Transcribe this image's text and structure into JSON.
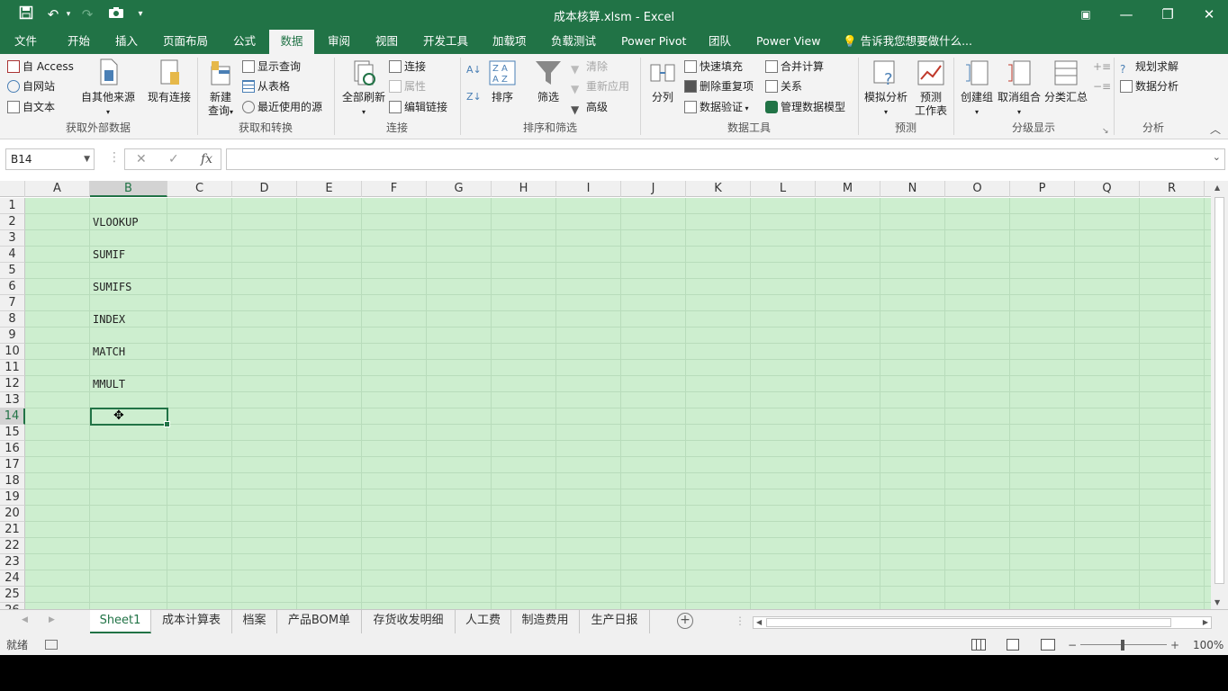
{
  "window": {
    "title": "成本核算.xlsm - Excel",
    "qat": [
      "save-icon",
      "undo-icon",
      "redo-icon",
      "camera-icon",
      "customize-icon"
    ],
    "controls": {
      "ribbon_options": "▣",
      "minimize": "—",
      "restore": "❐",
      "close": "✕"
    }
  },
  "tabs": [
    "文件",
    "开始",
    "插入",
    "页面布局",
    "公式",
    "数据",
    "审阅",
    "视图",
    "开发工具",
    "加载项",
    "负载测试",
    "Power Pivot",
    "团队",
    "Power View"
  ],
  "active_tab": "数据",
  "tell_me": "告诉我您想要做什么...",
  "ribbon": {
    "get_external": {
      "label": "获取外部数据",
      "access": "自 Access",
      "web": "自网站",
      "text": "自文本",
      "other": "自其他来源",
      "existing": "现有连接"
    },
    "get_transform": {
      "label": "获取和转换",
      "new_query_1": "新建",
      "new_query_2": "查询",
      "show_queries": "显示查询",
      "from_table": "从表格",
      "recent_sources": "最近使用的源"
    },
    "connections": {
      "label": "连接",
      "refresh_all": "全部刷新",
      "connections": "连接",
      "properties": "属性",
      "edit_links": "编辑链接"
    },
    "sort_filter": {
      "label": "排序和筛选",
      "sort": "排序",
      "filter": "筛选",
      "clear": "清除",
      "reapply": "重新应用",
      "advanced": "高级"
    },
    "data_tools": {
      "label": "数据工具",
      "text_to_columns": "分列",
      "flash_fill": "快速填充",
      "remove_dup": "删除重复项",
      "validation": "数据验证",
      "consolidate": "合并计算",
      "relationships": "关系",
      "manage_model": "管理数据模型"
    },
    "forecast": {
      "label": "预测",
      "what_if": "模拟分析",
      "sheet_1": "预测",
      "sheet_2": "工作表"
    },
    "outline": {
      "label": "分级显示",
      "group": "创建组",
      "ungroup": "取消组合",
      "subtotal": "分类汇总"
    },
    "analysis": {
      "label": "分析",
      "solver": "规划求解",
      "data_analysis": "数据分析"
    }
  },
  "formula_bar": {
    "name_box": "B14",
    "cancel": "✕",
    "enter": "✓",
    "fx": "fx",
    "value": ""
  },
  "grid": {
    "columns": [
      "A",
      "B",
      "C",
      "D",
      "E",
      "F",
      "G",
      "H",
      "I",
      "J",
      "K",
      "L",
      "M",
      "N",
      "O",
      "P",
      "Q",
      "R"
    ],
    "rows": [
      "1",
      "2",
      "3",
      "4",
      "5",
      "6",
      "7",
      "8",
      "9",
      "10",
      "11",
      "12",
      "13",
      "14",
      "15",
      "16",
      "17",
      "18",
      "19",
      "20",
      "21",
      "22",
      "23",
      "24",
      "25",
      "26"
    ],
    "cells": [
      {
        "ref": "B2",
        "text": "VLOOKUP"
      },
      {
        "ref": "B4",
        "text": "SUMIF"
      },
      {
        "ref": "B6",
        "text": "SUMIFS"
      },
      {
        "ref": "B8",
        "text": "INDEX"
      },
      {
        "ref": "B10",
        "text": "MATCH"
      },
      {
        "ref": "B12",
        "text": "MMULT"
      }
    ],
    "selected": "B14",
    "cell_color": "#cdeecf"
  },
  "sheets": [
    "Sheet1",
    "成本计算表",
    "档案",
    "产品BOM单",
    "存货收发明细",
    "人工费",
    "制造费用",
    "生产日报"
  ],
  "active_sheet": "Sheet1",
  "status": {
    "ready": "就绪",
    "zoom": "100%"
  },
  "colors": {
    "accent": "#217346"
  }
}
